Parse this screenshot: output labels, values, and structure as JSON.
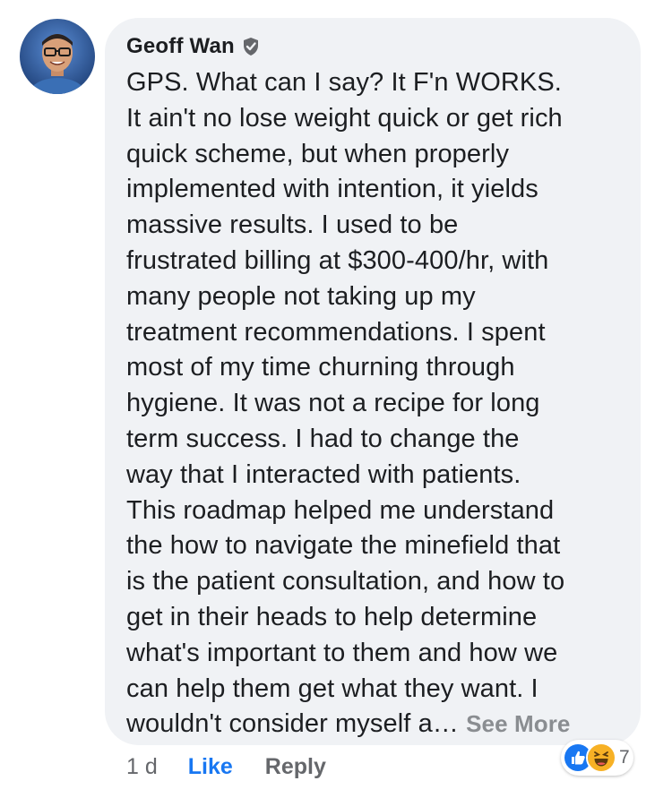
{
  "comment": {
    "author": "Geoff Wan",
    "verified_icon": "verified-badge-icon",
    "text": "GPS.  What can I say?  It F'n WORKS.\nIt ain't no lose weight quick or get rich\nquick scheme, but when properly\nimplemented with intention, it yields\nmassive results.  I used to be\nfrustrated billing at $300-400/hr, with\nmany people not taking up my\ntreatment recommendations.  I spent\nmost of my time churning through\nhygiene.  It was not a recipe for long\nterm success.  I had to change the\nway that I interacted with patients.\nThis roadmap helped me understand\nthe how to navigate the minefield that\nis the patient consultation, and how to\nget in their heads to help determine\nwhat's important to them and how we\ncan help them get what they want.  I\nwouldn't consider myself a…",
    "see_more": "See More",
    "timestamp": "1 d",
    "like_label": "Like",
    "reply_label": "Reply",
    "reactions": {
      "icons": [
        "like-reaction-icon",
        "haha-reaction-icon"
      ],
      "count": "7"
    }
  },
  "colors": {
    "bubble_background": "#f0f2f5",
    "like_blue": "#1877f2",
    "secondary_text": "#65676b",
    "see_more_gray": "#8a8d91"
  }
}
